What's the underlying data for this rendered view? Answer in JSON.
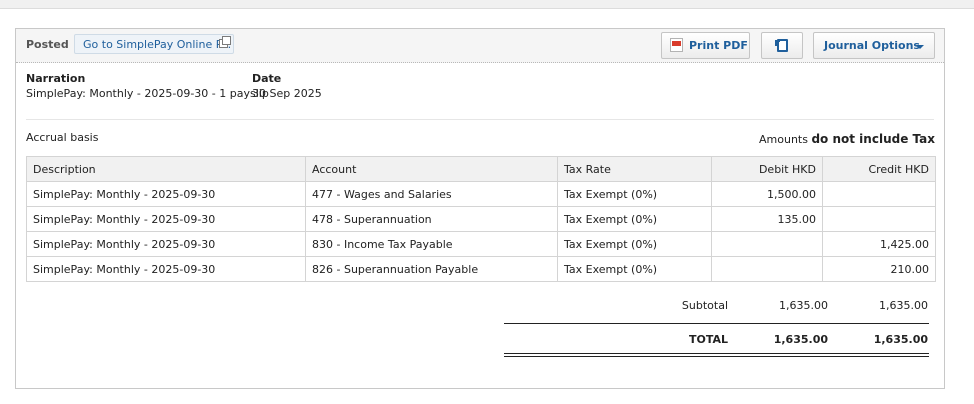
{
  "header": {
    "status": "Posted",
    "link_label": "Go to SimplePay Online P...",
    "print_pdf_label": "Print PDF",
    "journal_options_label": "Journal Options"
  },
  "details": {
    "narration_label": "Narration",
    "narration_value": "SimplePay: Monthly - 2025-09-30 - 1 payslip",
    "date_label": "Date",
    "date_value": "30 Sep 2025"
  },
  "basis": "Accrual basis",
  "amounts": {
    "prefix": "Amounts",
    "mode": "do not include Tax"
  },
  "table": {
    "columns": [
      "Description",
      "Account",
      "Tax Rate",
      "Debit HKD",
      "Credit HKD"
    ],
    "rows": [
      [
        "SimplePay: Monthly - 2025-09-30",
        "477 - Wages and Salaries",
        "Tax Exempt (0%)",
        "1,500.00",
        ""
      ],
      [
        "SimplePay: Monthly - 2025-09-30",
        "478 - Superannuation",
        "Tax Exempt (0%)",
        "135.00",
        ""
      ],
      [
        "SimplePay: Monthly - 2025-09-30",
        "830 - Income Tax Payable",
        "Tax Exempt (0%)",
        "",
        "1,425.00"
      ],
      [
        "SimplePay: Monthly - 2025-09-30",
        "826 - Superannuation Payable",
        "Tax Exempt (0%)",
        "",
        "210.00"
      ]
    ]
  },
  "totals": {
    "subtotal_label": "Subtotal",
    "subtotal_debit": "1,635.00",
    "subtotal_credit": "1,635.00",
    "total_label": "TOTAL",
    "total_debit": "1,635.00",
    "total_credit": "1,635.00"
  },
  "icons": {
    "external_link": "external-link-icon",
    "pdf": "pdf-icon",
    "copy": "copy-icon",
    "dropdown": "chevron-down-icon"
  }
}
